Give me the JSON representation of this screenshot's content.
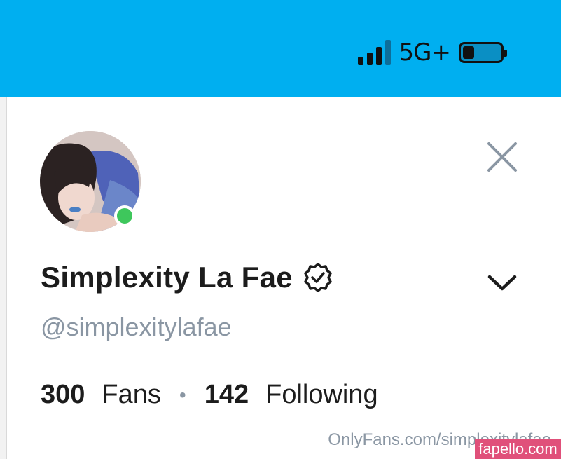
{
  "status_bar": {
    "network": "5G+",
    "signal_icon": "signal-icon",
    "battery_icon": "battery-icon"
  },
  "profile": {
    "name": "Simplexity La Fae",
    "handle": "@simplexitylafae",
    "fans_count": "300",
    "fans_label": "Fans",
    "separator": "•",
    "following_count": "142",
    "following_label": "Following",
    "online": true,
    "verified_icon": "verified-badge-icon"
  },
  "footer": {
    "url": "OnlyFans.com/simplexitylafae"
  },
  "watermark": {
    "text": "fapello.com"
  },
  "colors": {
    "status_bar": "#00aff0",
    "online": "#3ec75c",
    "muted": "#8a96a3",
    "watermark": "#e0507a"
  }
}
